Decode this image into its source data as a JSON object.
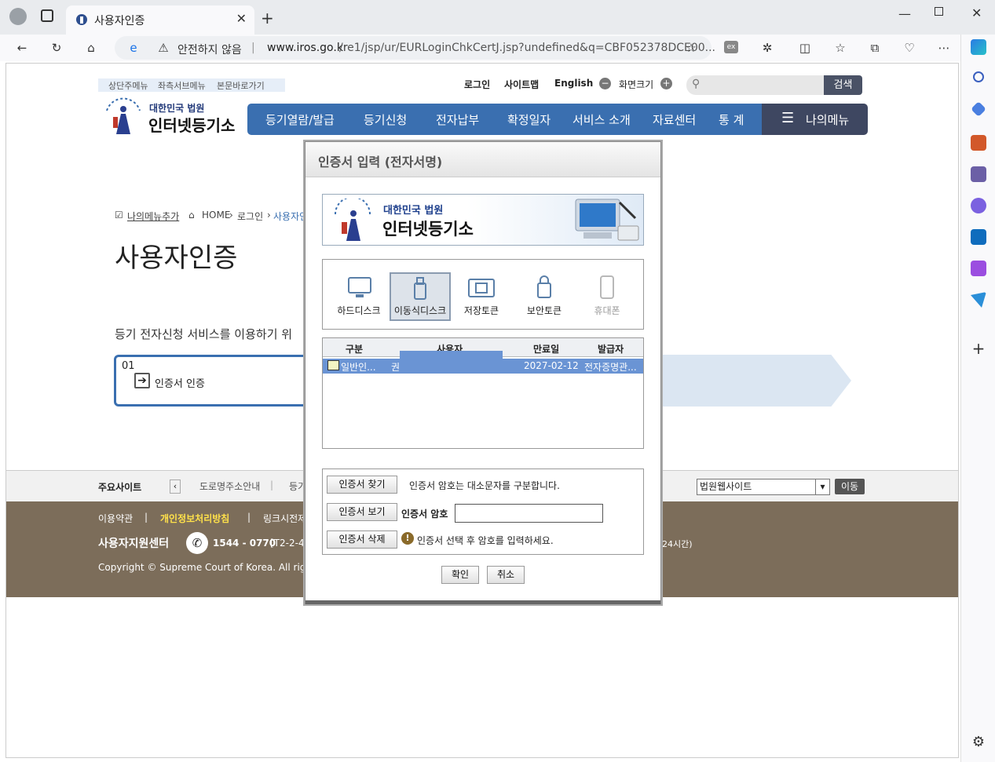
{
  "browser": {
    "tab_title": "사용자인증",
    "security_label": "안전하지 않음",
    "url_domain": "www.iros.go.kr",
    "url_path": "/re1/jsp/ur/EURLoginChkCertJ.jsp?undefined&q=CBF052378DCE00..."
  },
  "site": {
    "skip_links": [
      "상단주메뉴",
      "좌측서브메뉴",
      "본문바로가기"
    ],
    "util_links": [
      "로그인",
      "사이트맵",
      "English"
    ],
    "screen_size_label": "화면크기",
    "search_button": "검색",
    "logo_title": "대한민국 법원",
    "logo_main": "인터넷등기소",
    "nav": [
      "등기열람/발급",
      "등기신청",
      "전자납부",
      "확정일자",
      "서비스 소개",
      "자료센터",
      "통 계"
    ],
    "my_menu": "나의메뉴",
    "add_my_menu": "나의메뉴추가",
    "breadcrumb": [
      "HOME",
      "로그인",
      "사용자인"
    ],
    "page_title": "사용자인증",
    "description": "등기 전자신청 서비스를 이용하기 위",
    "step_number": "01",
    "step_label": "인증서 인증",
    "footer": {
      "main_sites_label": "주요사이트",
      "site_links": [
        "도로명주소안내",
        "등기"
      ],
      "site_select": "법원웹사이트",
      "go_button": "이동",
      "links": [
        "이용약관",
        "개인정보처리방침",
        "링크시전제"
      ],
      "support_center": "사용자지원센터",
      "phone": "1544 - 0770",
      "phone_extra": "[T2-2-4",
      "hours_tail": "24시간)",
      "copyright": "Copyright © Supreme Court of Korea. All rights"
    }
  },
  "modal": {
    "title": "인증서 입력 (전자서명)",
    "banner_sub": "대한민국 법원",
    "banner_main": "인터넷등기소",
    "storage": [
      {
        "label": "하드디스크",
        "icon": "monitor-icon",
        "selected": false
      },
      {
        "label": "이동식디스크",
        "icon": "usb-icon",
        "selected": true
      },
      {
        "label": "저장토큰",
        "icon": "token-icon",
        "selected": false
      },
      {
        "label": "보안토큰",
        "icon": "lock-icon",
        "selected": false
      },
      {
        "label": "휴대폰",
        "icon": "phone-icon",
        "selected": false
      }
    ],
    "table_headers": [
      "구분",
      "사용자",
      "만료일",
      "발급자"
    ],
    "cert_row": {
      "type": "일반인...",
      "user": "권",
      "expiry": "2027-02-12",
      "issuer": "전자증명관..."
    },
    "find_button": "인증서 찾기",
    "view_button": "인증서 보기",
    "delete_button": "인증서 삭제",
    "case_notice": "인증서 암호는 대소문자를 구분합니다.",
    "password_label": "인증서 암호",
    "warning_text": "인증서 선택 후 암호를 입력하세요.",
    "confirm_button": "확인",
    "cancel_button": "취소"
  },
  "colors": {
    "nav_blue": "#3a6fb0",
    "selected_row": "#6a94d4",
    "footer_brown": "#7c6d5a"
  }
}
